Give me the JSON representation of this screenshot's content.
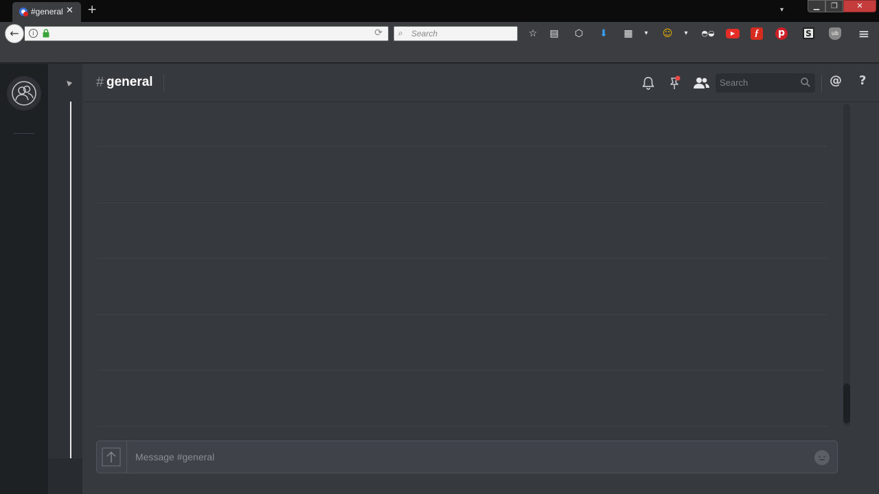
{
  "browser": {
    "tab": {
      "title": "#general",
      "close": "✕"
    },
    "new_tab": "+",
    "tabs_menu": "▾",
    "window": {
      "minimize": "▁",
      "maximize": "❐",
      "close": "✕"
    },
    "nav": {
      "back": "←",
      "info": "i",
      "reload": "⟳"
    },
    "search": {
      "placeholder": "Search",
      "icon": "⌕"
    },
    "toolbar": {
      "bookmark_star": "☆",
      "reader": "▤",
      "pocket": "⬡",
      "downloads": "⬇",
      "grid": "▦",
      "dropdown": "▾",
      "ext_face": "☺",
      "ext_mask": "◓◒",
      "youtube": "▶",
      "flash": "ƒ",
      "pinterest": "p",
      "stylish": "S",
      "ublock": "ub",
      "menu": "≡"
    },
    "colors": {
      "youtube": "#e52d27",
      "pinterest": "#cb2027",
      "flash": "#d62b1f",
      "downloads": "#3a9ff0"
    }
  },
  "app": {
    "channel": {
      "hash": "#",
      "name": "general"
    },
    "header": {
      "search_placeholder": "Search",
      "mention": "@",
      "help": "?"
    },
    "composer": {
      "placeholder": "Message #general"
    },
    "colors": {
      "background": "#36393e",
      "sidebar": "#2e3136",
      "guilds": "#1e2124",
      "pin_badge": "#f04747"
    }
  }
}
